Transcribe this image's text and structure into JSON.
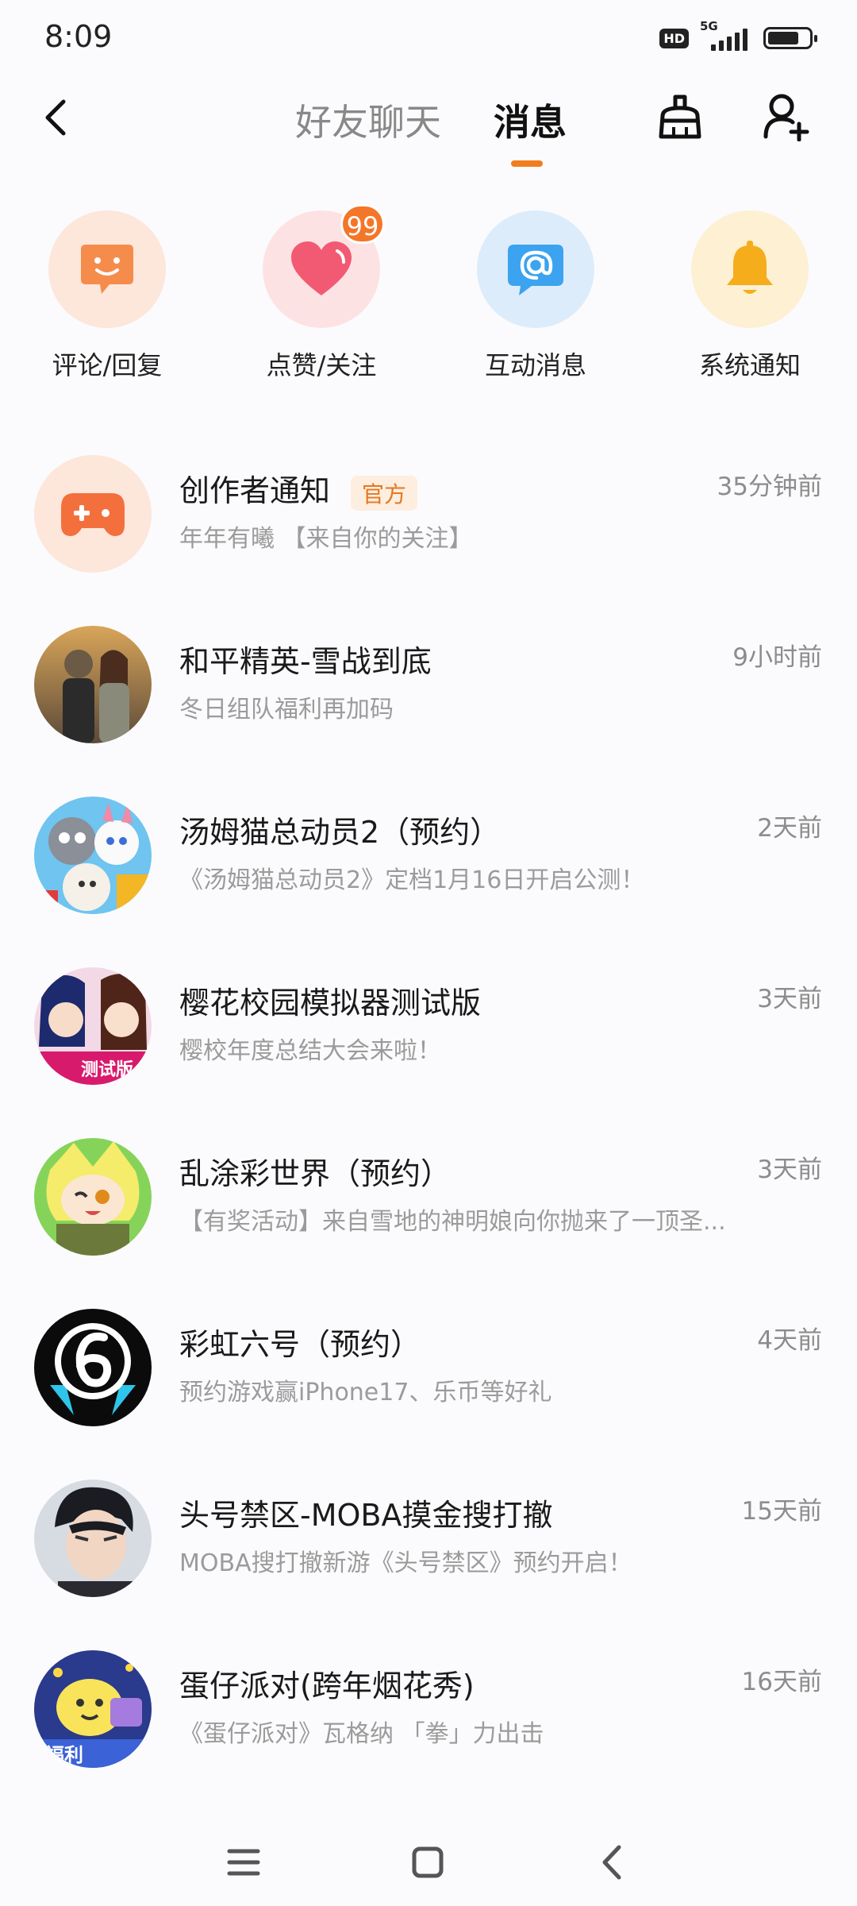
{
  "status_bar": {
    "time": "8:09",
    "hd": "HD",
    "network": "5G",
    "battery_level": 0.75
  },
  "header": {
    "back_icon": "chevron-left-icon",
    "tabs": [
      {
        "label": "好友聊天",
        "active": false
      },
      {
        "label": "消息",
        "active": true
      }
    ],
    "accent_color": "#f27c1e",
    "right_icons": [
      "broom-clean-icon",
      "add-user-icon"
    ]
  },
  "quick_actions": [
    {
      "label": "评论/回复",
      "icon": "comment-smile-icon",
      "color": "#f58c4c"
    },
    {
      "label": "点赞/关注",
      "icon": "heart-icon",
      "color": "#f25a73",
      "badge": "99"
    },
    {
      "label": "互动消息",
      "icon": "at-sign-icon",
      "color": "#3ba3ef"
    },
    {
      "label": "系统通知",
      "icon": "bell-icon",
      "color": "#f5ad1b"
    }
  ],
  "messages": [
    {
      "name": "创作者通知",
      "tag": "官方",
      "time": "35分钟前",
      "preview": "年年有曦 【来自你的关注】"
    },
    {
      "name": "和平精英-雪战到底",
      "time": "9小时前",
      "preview": "冬日组队福利再加码"
    },
    {
      "name": "汤姆猫总动员2（预约）",
      "time": "2天前",
      "preview": "《汤姆猫总动员2》定档1月16日开启公测！"
    },
    {
      "name": "樱花校园模拟器测试版",
      "time": "3天前",
      "preview": "樱校年度总结大会来啦！"
    },
    {
      "name": "乱涂彩世界（预约）",
      "time": "3天前",
      "preview": "【有奖活动】来自雪地的神明娘向你抛来了一顶圣..."
    },
    {
      "name": "彩虹六号（预约）",
      "time": "4天前",
      "preview": "预约游戏赢iPhone17、乐币等好礼"
    },
    {
      "name": "头号禁区-MOBA摸金搜打撤",
      "time": "15天前",
      "preview": "MOBA搜打撤新游《头号禁区》预约开启！"
    },
    {
      "name": "蛋仔派对(跨年烟花秀)",
      "time": "16天前",
      "preview": "《蛋仔派对》瓦格纳 「拳」力出击"
    }
  ],
  "nav_bar": [
    "menu-icon",
    "home-square-icon",
    "back-triangle-icon"
  ]
}
